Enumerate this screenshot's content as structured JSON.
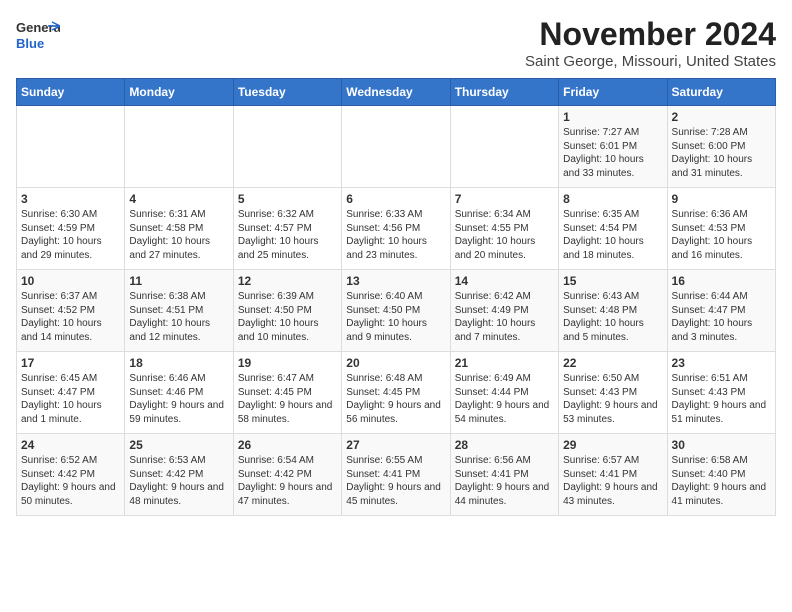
{
  "header": {
    "logo_line1": "General",
    "logo_line2": "Blue",
    "month": "November 2024",
    "location": "Saint George, Missouri, United States"
  },
  "days_of_week": [
    "Sunday",
    "Monday",
    "Tuesday",
    "Wednesday",
    "Thursday",
    "Friday",
    "Saturday"
  ],
  "weeks": [
    [
      {
        "day": "",
        "info": ""
      },
      {
        "day": "",
        "info": ""
      },
      {
        "day": "",
        "info": ""
      },
      {
        "day": "",
        "info": ""
      },
      {
        "day": "",
        "info": ""
      },
      {
        "day": "1",
        "info": "Sunrise: 7:27 AM\nSunset: 6:01 PM\nDaylight: 10 hours and 33 minutes."
      },
      {
        "day": "2",
        "info": "Sunrise: 7:28 AM\nSunset: 6:00 PM\nDaylight: 10 hours and 31 minutes."
      }
    ],
    [
      {
        "day": "3",
        "info": "Sunrise: 6:30 AM\nSunset: 4:59 PM\nDaylight: 10 hours and 29 minutes."
      },
      {
        "day": "4",
        "info": "Sunrise: 6:31 AM\nSunset: 4:58 PM\nDaylight: 10 hours and 27 minutes."
      },
      {
        "day": "5",
        "info": "Sunrise: 6:32 AM\nSunset: 4:57 PM\nDaylight: 10 hours and 25 minutes."
      },
      {
        "day": "6",
        "info": "Sunrise: 6:33 AM\nSunset: 4:56 PM\nDaylight: 10 hours and 23 minutes."
      },
      {
        "day": "7",
        "info": "Sunrise: 6:34 AM\nSunset: 4:55 PM\nDaylight: 10 hours and 20 minutes."
      },
      {
        "day": "8",
        "info": "Sunrise: 6:35 AM\nSunset: 4:54 PM\nDaylight: 10 hours and 18 minutes."
      },
      {
        "day": "9",
        "info": "Sunrise: 6:36 AM\nSunset: 4:53 PM\nDaylight: 10 hours and 16 minutes."
      }
    ],
    [
      {
        "day": "10",
        "info": "Sunrise: 6:37 AM\nSunset: 4:52 PM\nDaylight: 10 hours and 14 minutes."
      },
      {
        "day": "11",
        "info": "Sunrise: 6:38 AM\nSunset: 4:51 PM\nDaylight: 10 hours and 12 minutes."
      },
      {
        "day": "12",
        "info": "Sunrise: 6:39 AM\nSunset: 4:50 PM\nDaylight: 10 hours and 10 minutes."
      },
      {
        "day": "13",
        "info": "Sunrise: 6:40 AM\nSunset: 4:50 PM\nDaylight: 10 hours and 9 minutes."
      },
      {
        "day": "14",
        "info": "Sunrise: 6:42 AM\nSunset: 4:49 PM\nDaylight: 10 hours and 7 minutes."
      },
      {
        "day": "15",
        "info": "Sunrise: 6:43 AM\nSunset: 4:48 PM\nDaylight: 10 hours and 5 minutes."
      },
      {
        "day": "16",
        "info": "Sunrise: 6:44 AM\nSunset: 4:47 PM\nDaylight: 10 hours and 3 minutes."
      }
    ],
    [
      {
        "day": "17",
        "info": "Sunrise: 6:45 AM\nSunset: 4:47 PM\nDaylight: 10 hours and 1 minute."
      },
      {
        "day": "18",
        "info": "Sunrise: 6:46 AM\nSunset: 4:46 PM\nDaylight: 9 hours and 59 minutes."
      },
      {
        "day": "19",
        "info": "Sunrise: 6:47 AM\nSunset: 4:45 PM\nDaylight: 9 hours and 58 minutes."
      },
      {
        "day": "20",
        "info": "Sunrise: 6:48 AM\nSunset: 4:45 PM\nDaylight: 9 hours and 56 minutes."
      },
      {
        "day": "21",
        "info": "Sunrise: 6:49 AM\nSunset: 4:44 PM\nDaylight: 9 hours and 54 minutes."
      },
      {
        "day": "22",
        "info": "Sunrise: 6:50 AM\nSunset: 4:43 PM\nDaylight: 9 hours and 53 minutes."
      },
      {
        "day": "23",
        "info": "Sunrise: 6:51 AM\nSunset: 4:43 PM\nDaylight: 9 hours and 51 minutes."
      }
    ],
    [
      {
        "day": "24",
        "info": "Sunrise: 6:52 AM\nSunset: 4:42 PM\nDaylight: 9 hours and 50 minutes."
      },
      {
        "day": "25",
        "info": "Sunrise: 6:53 AM\nSunset: 4:42 PM\nDaylight: 9 hours and 48 minutes."
      },
      {
        "day": "26",
        "info": "Sunrise: 6:54 AM\nSunset: 4:42 PM\nDaylight: 9 hours and 47 minutes."
      },
      {
        "day": "27",
        "info": "Sunrise: 6:55 AM\nSunset: 4:41 PM\nDaylight: 9 hours and 45 minutes."
      },
      {
        "day": "28",
        "info": "Sunrise: 6:56 AM\nSunset: 4:41 PM\nDaylight: 9 hours and 44 minutes."
      },
      {
        "day": "29",
        "info": "Sunrise: 6:57 AM\nSunset: 4:41 PM\nDaylight: 9 hours and 43 minutes."
      },
      {
        "day": "30",
        "info": "Sunrise: 6:58 AM\nSunset: 4:40 PM\nDaylight: 9 hours and 41 minutes."
      }
    ]
  ]
}
